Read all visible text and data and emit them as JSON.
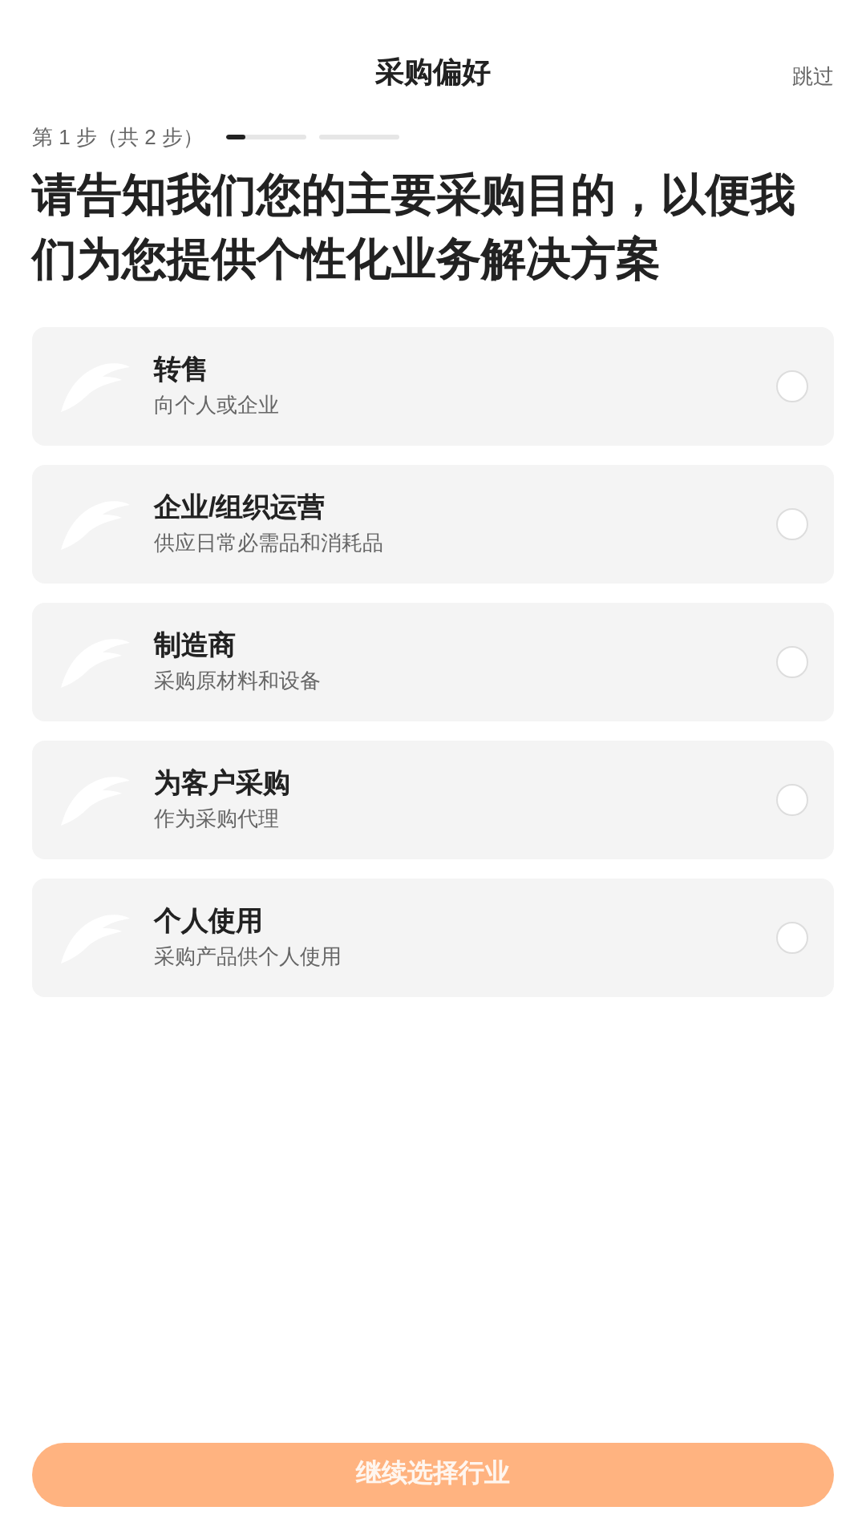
{
  "header": {
    "title": "采购偏好",
    "skip": "跳过"
  },
  "progress": {
    "label": "第 1 步（共 2 步）",
    "level": 0.25,
    "steps": [
      {
        "selected": true
      },
      {
        "selected": false
      }
    ]
  },
  "question": "请告知我们您的主要采购目的，以便我们为您提供个性化业务解决方案",
  "options": [
    {
      "title": "转售",
      "subtitle": "向个人或企业",
      "selected": false
    },
    {
      "title": "企业/组织运营",
      "subtitle": "供应日常必需品和消耗品",
      "selected": false
    },
    {
      "title": "制造商",
      "subtitle": "采购原材料和设备",
      "selected": false
    },
    {
      "title": "为客户采购",
      "subtitle": "作为采购代理",
      "selected": false
    },
    {
      "title": "个人使用",
      "subtitle": "采购产品供个人使用",
      "selected": false
    }
  ],
  "continue_button": {
    "label": "继续选择行业",
    "disabled": true
  }
}
